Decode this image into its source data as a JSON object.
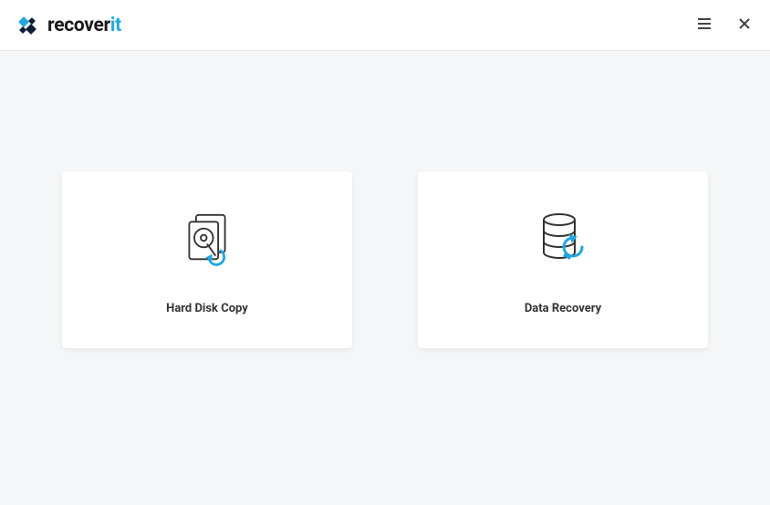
{
  "app": {
    "brand_prefix": "recover",
    "brand_accent": "it"
  },
  "cards": {
    "hard_disk_copy": {
      "label": "Hard Disk Copy"
    },
    "data_recovery": {
      "label": "Data Recovery"
    }
  },
  "colors": {
    "accent": "#1fa8e0",
    "icon_stroke": "#333"
  }
}
